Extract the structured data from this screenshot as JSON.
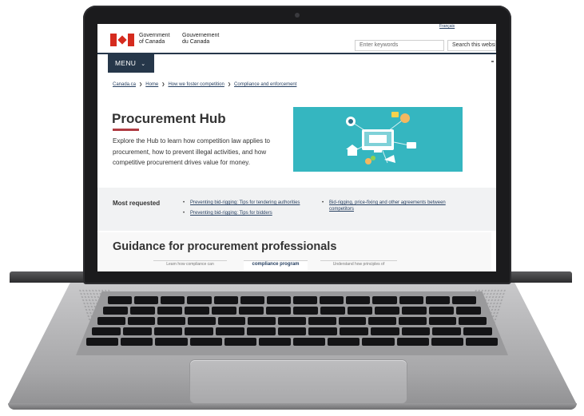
{
  "header": {
    "signature_en": [
      "Government",
      "of Canada"
    ],
    "signature_fr": [
      "Gouvernement",
      "du Canada"
    ],
    "language_link": "Français",
    "search_placeholder": "Enter keywords",
    "search_button": "Search this website"
  },
  "menu": {
    "label": "MENU"
  },
  "breadcrumb": [
    "Canada.ca",
    "Home",
    "How we foster competition",
    "Compliance and enforcement"
  ],
  "page": {
    "title": "Procurement Hub",
    "intro": "Explore the Hub to learn how competition law applies to procurement, how to prevent illegal activities, and how competitive procurement drives value for money."
  },
  "most_requested": {
    "label": "Most requested",
    "col1": [
      "Preventing bid-rigging: Tips for tendering authorities",
      "Preventing bid-rigging: Tips for bidders"
    ],
    "col2": [
      "Bid-rigging, price-fixing and other agreements between competitors"
    ]
  },
  "guidance": {
    "title": "Guidance for procurement professionals",
    "cards": [
      "Learn how compliance can",
      "compliance program",
      "Understand how principles of"
    ]
  },
  "colors": {
    "gc_navy": "#26374a",
    "gc_red": "#af3c43",
    "link": "#284162",
    "hero_teal": "#35b6c0"
  }
}
